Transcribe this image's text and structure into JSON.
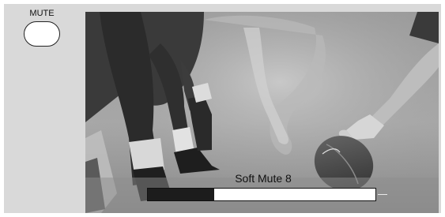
{
  "remote": {
    "button_label": "MUTE"
  },
  "screen": {
    "image": "black-and-white football photo of a lineman's hands at the line of scrimmage and a hand on the ball",
    "osd": {
      "label": "Soft Mute 8",
      "volume_fraction": 0.29
    }
  },
  "colors": {
    "background_panel": "#d9d9d9",
    "bar_fill": "#1c1c1c",
    "bar_empty": "#ffffff"
  }
}
